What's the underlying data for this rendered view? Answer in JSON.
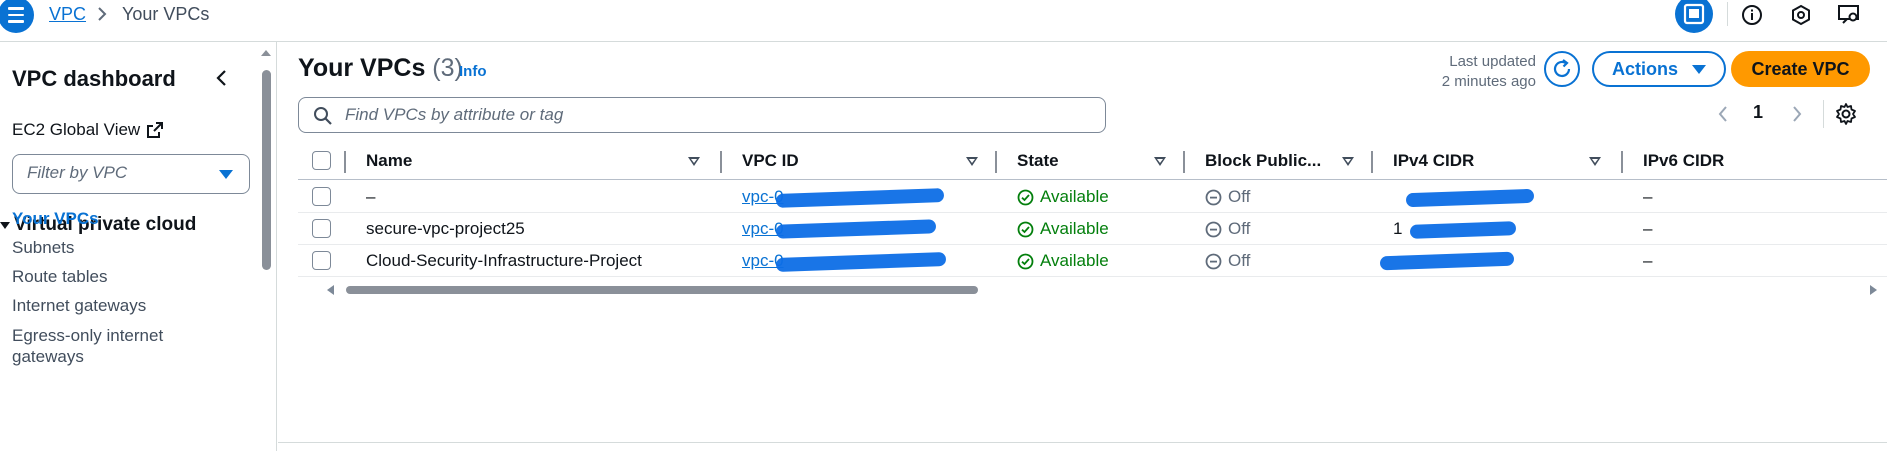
{
  "breadcrumb": {
    "root": "VPC",
    "current": "Your VPCs"
  },
  "icons": {
    "menu": "hamburger-icon",
    "split_panel": "split-panel-icon",
    "info": "info-icon",
    "notifications": "hexagon-settings-icon",
    "feedback": "feedback-icon"
  },
  "sidebar": {
    "title": "VPC dashboard",
    "ec2_global_view": "EC2 Global View",
    "filter_placeholder": "Filter by VPC",
    "section": "Virtual private cloud",
    "items": [
      {
        "label": "Your VPCs",
        "active": true
      },
      {
        "label": "Subnets"
      },
      {
        "label": "Route tables"
      },
      {
        "label": "Internet gateways"
      },
      {
        "label": "Egress-only internet gateways"
      }
    ]
  },
  "header": {
    "title": "Your VPCs",
    "count": "(3)",
    "info": "Info",
    "last_updated_line1": "Last updated",
    "last_updated_line2": "2 minutes ago",
    "actions_label": "Actions",
    "create_label": "Create VPC"
  },
  "search": {
    "placeholder": "Find VPCs by attribute or tag"
  },
  "pagination": {
    "current_page": "1"
  },
  "table": {
    "columns": [
      "Name",
      "VPC ID",
      "State",
      "Block Public...",
      "IPv4 CIDR",
      "IPv6 CIDR"
    ],
    "rows": [
      {
        "name": "–",
        "vpc_id": "vpc-0",
        "state": "Available",
        "block": "Off",
        "ipv4": "",
        "ipv6": "–"
      },
      {
        "name": "secure-vpc-project25",
        "vpc_id": "vpc-0",
        "state": "Available",
        "block": "Off",
        "ipv4": "1",
        "ipv6": "–"
      },
      {
        "name": "Cloud-Security-Infrastructure-Project",
        "vpc_id": "vpc-0",
        "state": "Available",
        "block": "Off",
        "ipv4": "",
        "ipv6": "–"
      }
    ]
  },
  "colors": {
    "accent": "#0972d3",
    "primary_button": "#ff9900",
    "available": "#037f0c",
    "redaction": "#0d6ee6"
  }
}
